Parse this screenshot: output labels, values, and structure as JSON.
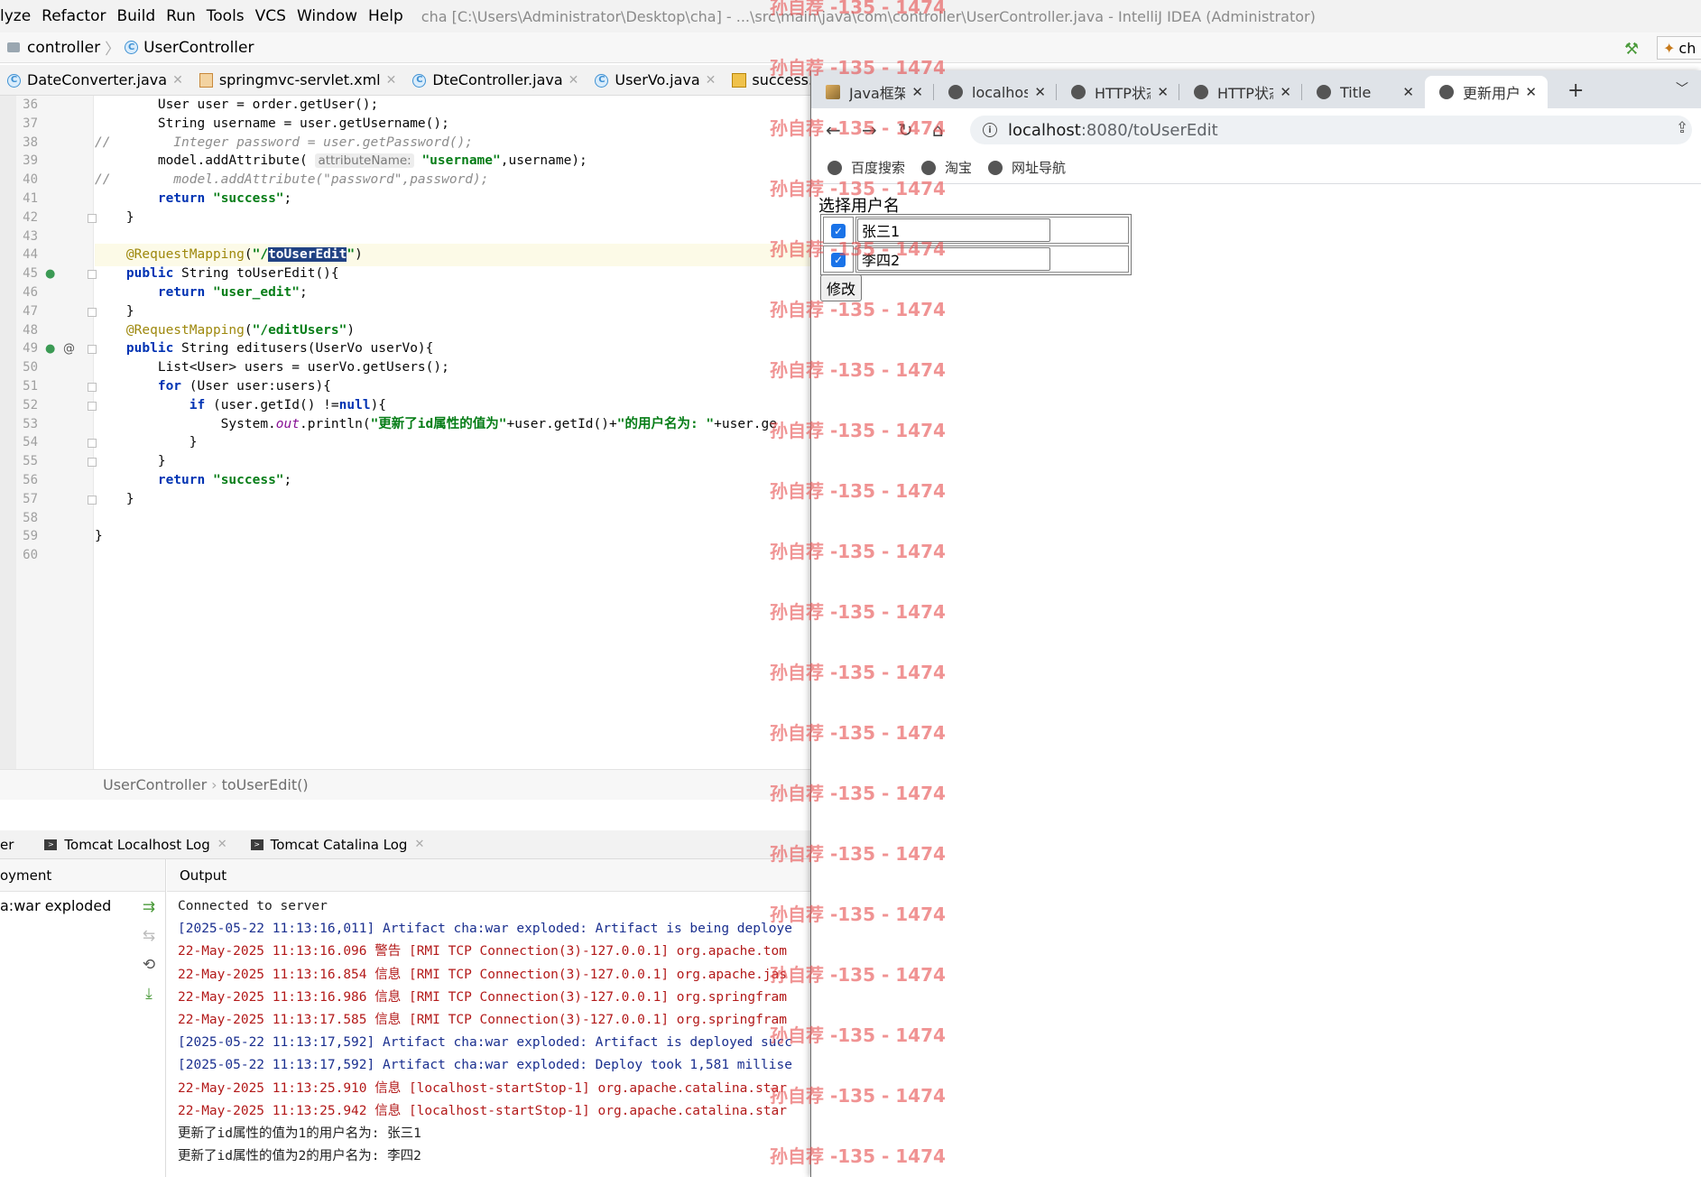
{
  "menu": {
    "items": [
      "lyze",
      "Refactor",
      "Build",
      "Run",
      "Tools",
      "VCS",
      "Window",
      "Help"
    ],
    "window_title": "cha [C:\\Users\\Administrator\\Desktop\\cha] - ...\\src\\main\\java\\com\\controller\\UserController.java - IntelliJ IDEA (Administrator)"
  },
  "nav": {
    "folder": "controller",
    "file": "UserController",
    "run_config": "ch"
  },
  "file_tabs": [
    {
      "label": "DateConverter.java",
      "icon": "class-icon"
    },
    {
      "label": "springmvc-servlet.xml",
      "icon": "xml-icon"
    },
    {
      "label": "DteController.java",
      "icon": "class-icon"
    },
    {
      "label": "UserVo.java",
      "icon": "class-icon"
    },
    {
      "label": "success.jsp",
      "icon": "jsp-icon"
    }
  ],
  "code": {
    "line_numbers": [
      "36",
      "37",
      "38",
      "39",
      "40",
      "41",
      "42",
      "43",
      "44",
      "45",
      "46",
      "47",
      "48",
      "49",
      "50",
      "51",
      "52",
      "53",
      "54",
      "55",
      "56",
      "57",
      "58",
      "59",
      "60"
    ],
    "lines": [
      "        User user = order.getUser();",
      "        String username = user.getUsername();",
      "//        Integer password = user.getPassword();",
      "        model.addAttribute( attributeName: \"username\",username);",
      "//        model.addAttribute(\"password\",password);",
      "        return \"success\";",
      "    }",
      "",
      "    @RequestMapping(\"/toUserEdit\")",
      "    public String toUserEdit(){",
      "        return \"user_edit\";",
      "    }",
      "    @RequestMapping(\"/editUsers\")",
      "    public String editusers(UserVo userVo){",
      "        List<User> users = userVo.getUsers();",
      "        for (User user:users){",
      "            if (user.getId() !=null){",
      "                System.out.println(\"更新了id属性的值为\"+user.getId()+\"的用户名为: \"+user.ge",
      "            }",
      "        }",
      "        return \"success\";",
      "    }",
      "",
      "}",
      ""
    ],
    "breadcrumb": [
      "UserController",
      "toUserEdit()"
    ]
  },
  "services": {
    "tabs": [
      "er",
      "Tomcat Localhost Log",
      "Tomcat Catalina Log"
    ],
    "left_header": "oyment",
    "left_item": "a:war exploded",
    "output_header": "Output",
    "console": [
      {
        "text": "Connected to server",
        "color": "black"
      },
      {
        "text": "[2025-05-22 11:13:16,011] Artifact cha:war exploded: Artifact is being deploye",
        "color": "blue"
      },
      {
        "text": "22-May-2025 11:13:16.096 警告 [RMI TCP Connection(3)-127.0.0.1] org.apache.tom",
        "color": "red"
      },
      {
        "text": "22-May-2025 11:13:16.854 信息 [RMI TCP Connection(3)-127.0.0.1] org.apache.jas",
        "color": "red"
      },
      {
        "text": "22-May-2025 11:13:16.986 信息 [RMI TCP Connection(3)-127.0.0.1] org.springfram",
        "color": "red"
      },
      {
        "text": "22-May-2025 11:13:17.585 信息 [RMI TCP Connection(3)-127.0.0.1] org.springfram",
        "color": "red"
      },
      {
        "text": "[2025-05-22 11:13:17,592] Artifact cha:war exploded: Artifact is deployed succ",
        "color": "blue"
      },
      {
        "text": "[2025-05-22 11:13:17,592] Artifact cha:war exploded: Deploy took 1,581 millise",
        "color": "blue"
      },
      {
        "text": "22-May-2025 11:13:25.910 信息 [localhost-startStop-1] org.apache.catalina.star",
        "color": "red"
      },
      {
        "text": "22-May-2025 11:13:25.942 信息 [localhost-startStop-1] org.apache.catalina.star",
        "color": "red"
      },
      {
        "text": "更新了id属性的值为1的用户名为: 张三1",
        "color": "black"
      },
      {
        "text": "更新了id属性的值为2的用户名为: 李四2",
        "color": "black"
      }
    ]
  },
  "browser": {
    "tabs": [
      {
        "title": "Java框架",
        "active": false
      },
      {
        "title": "localhost",
        "active": false
      },
      {
        "title": "HTTP状态",
        "active": false
      },
      {
        "title": "HTTP状态",
        "active": false
      },
      {
        "title": "Title",
        "active": false
      },
      {
        "title": "更新用户",
        "active": true
      }
    ],
    "url_host": "localhost",
    "url_path": ":8080/toUserEdit",
    "bookmarks": [
      "百度搜索",
      "淘宝",
      "网址导航"
    ],
    "page": {
      "heading": "选择用户名",
      "users": [
        {
          "checked": true,
          "name": "张三1"
        },
        {
          "checked": true,
          "name": "李四2"
        }
      ],
      "submit_label": "修改"
    }
  },
  "watermark": "孙自荐 -135 - 1474"
}
